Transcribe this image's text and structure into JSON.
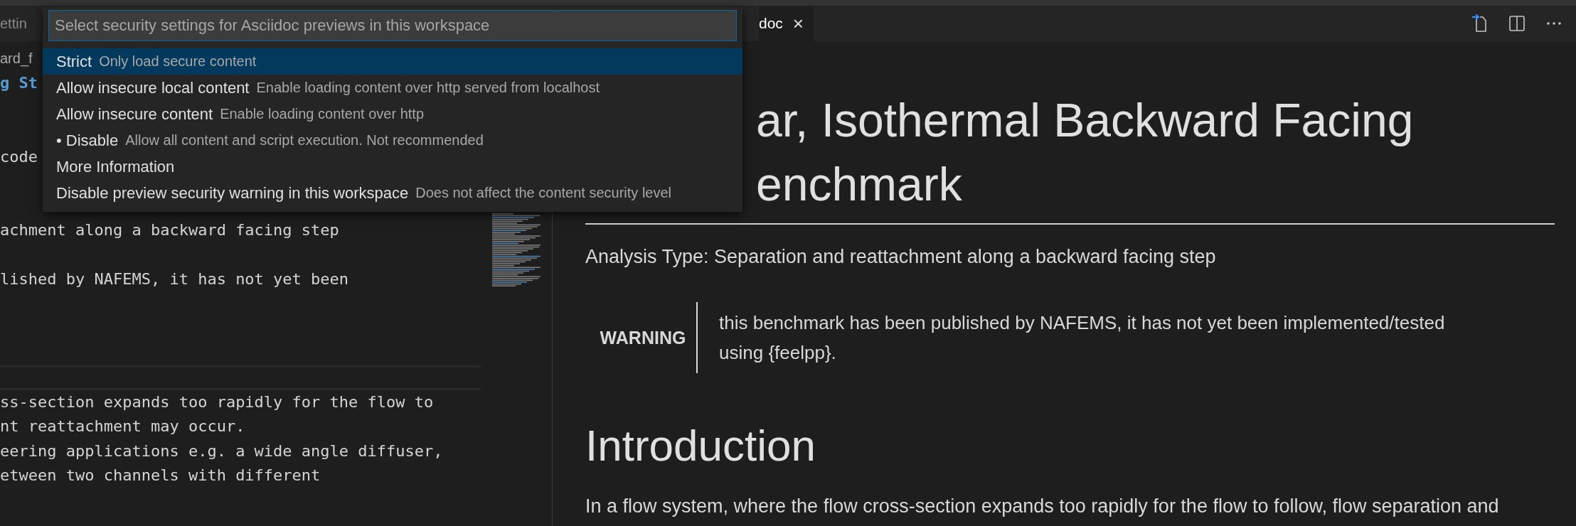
{
  "left_editor": {
    "tab": {
      "label": "ettin"
    },
    "breadcrumb": "ard_f",
    "code_lines": [
      {
        "kind": "heading",
        "text": "g St",
        "current": false
      },
      {
        "kind": "blank",
        "current": false
      },
      {
        "kind": "blank",
        "current": false
      },
      {
        "kind": "text",
        "text": "code",
        "current": false
      },
      {
        "kind": "blank",
        "current": false
      },
      {
        "kind": "blank",
        "current": false
      },
      {
        "kind": "text",
        "text": "achment along a backward facing step",
        "current": false
      },
      {
        "kind": "blank",
        "current": false
      },
      {
        "kind": "text",
        "text": "lished by NAFEMS, it has not yet been",
        "current": false
      },
      {
        "kind": "blank",
        "current": false
      },
      {
        "kind": "blank",
        "current": false
      },
      {
        "kind": "blank",
        "current": false
      },
      {
        "kind": "blank",
        "current": true
      },
      {
        "kind": "text",
        "text": "ss-section expands too rapidly for the flow to",
        "current": false
      },
      {
        "kind": "text",
        "text": "nt reattachment may occur.",
        "current": false
      },
      {
        "kind": "text",
        "text": "eering applications e.g. a wide angle diffuser,",
        "current": false
      },
      {
        "kind": "text",
        "text": "etween two channels with different",
        "current": false
      }
    ]
  },
  "preview": {
    "tab": {
      "label": "doc",
      "close": "×"
    },
    "title_lines": [
      "ar, Isothermal Backward Facing",
      "enchmark"
    ],
    "analysis_type": "Analysis Type: Separation and reattachment along a backward facing step",
    "admonition": {
      "label": "WARNING",
      "text": "this benchmark has been published by NAFEMS, it has not yet been implemented/tested using {feelpp}."
    },
    "section_title": "Introduction",
    "paragraph": "In a flow system, where the flow cross-section expands too rapidly for the flow to follow, flow separation and"
  },
  "quick_pick": {
    "placeholder": "Select security settings for Asciidoc previews in this workspace",
    "items": [
      {
        "label": "Strict",
        "description": "Only load secure content",
        "selected": true
      },
      {
        "label": "Allow insecure local content",
        "description": "Enable loading content over http served from localhost",
        "selected": false
      },
      {
        "label": "Allow insecure content",
        "description": "Enable loading content over http",
        "selected": false
      },
      {
        "label": "• Disable",
        "description": "Allow all content and script execution. Not recommended",
        "selected": false
      },
      {
        "label": "More Information",
        "selected": false
      },
      {
        "label": "Disable preview security warning in this workspace",
        "description": "Does not affect the content security level",
        "selected": false
      }
    ]
  }
}
